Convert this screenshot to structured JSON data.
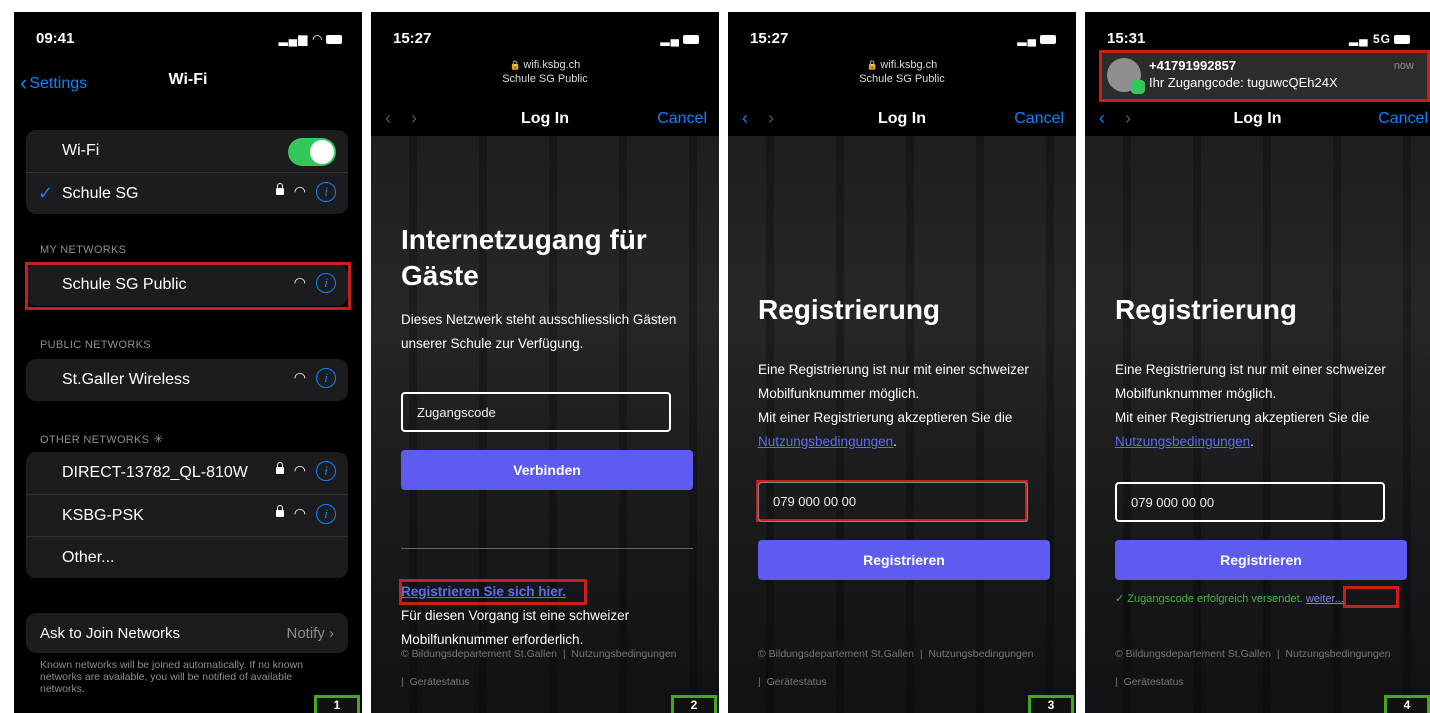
{
  "panel1": {
    "time": "09:41",
    "back_label": "Settings",
    "title": "Wi-Fi",
    "wifi_label": "Wi-Fi",
    "connected_network": "Schule SG",
    "my_networks_header": "MY NETWORKS",
    "my_networks": [
      "Schule SG Public"
    ],
    "public_networks_header": "PUBLIC NETWORKS",
    "public_networks": [
      "St.Galler Wireless"
    ],
    "other_networks_header": "OTHER NETWORKS",
    "other_networks": [
      "DIRECT-13782_QL-810W",
      "KSBG-PSK"
    ],
    "other_label": "Other...",
    "ask_join_label": "Ask to Join Networks",
    "ask_join_value": "Notify",
    "footnote": "Known networks will be joined automatically. If no known networks are available, you will be notified of available networks.",
    "step": "1"
  },
  "panel2": {
    "time": "15:27",
    "url": "wifi.ksbg.ch",
    "network": "Schule SG Public",
    "nav_title": "Log In",
    "cancel": "Cancel",
    "heading": "Internetzugang für Gäste",
    "text": "Dieses Netzwerk steht ausschliesslich Gästen unserer Schule zur Verfügung.",
    "code_placeholder": "Zugangscode",
    "connect_button": "Verbinden",
    "register_link": "Registrieren Sie sich hier.",
    "register_note": "Für diesen Vorgang ist eine schweizer Mobilfunknummer erforderlich.",
    "footer_dept": "© Bildungsdepartement St.Gallen",
    "footer_terms": "Nutzungsbedingungen",
    "footer_status": "Gerätestatus",
    "step": "2"
  },
  "panel3": {
    "time": "15:27",
    "url": "wifi.ksbg.ch",
    "network": "Schule SG Public",
    "nav_title": "Log In",
    "cancel": "Cancel",
    "heading": "Registrierung",
    "text_1": "Eine Registrierung ist nur mit einer schweizer Mobilfunknummer möglich.",
    "text_2": "Mit einer Registrierung akzeptieren Sie die",
    "terms_link": "Nutzungsbedingungen",
    "phone_value": "079 000 00 00",
    "register_button": "Registrieren",
    "footer_dept": "© Bildungsdepartement St.Gallen",
    "footer_terms": "Nutzungsbedingungen",
    "footer_status": "Gerätestatus",
    "step": "3"
  },
  "panel4": {
    "time": "15:31",
    "signal": "5G",
    "notif_sender": "+41791992857",
    "notif_message": "Ihr Zugangcode: tuguwcQEh24X",
    "notif_time": "now",
    "nav_title": "Log In",
    "cancel": "Cancel",
    "heading": "Registrierung",
    "text_1": "Eine Registrierung ist nur mit einer schweizer Mobilfunknummer möglich.",
    "text_2": "Mit einer Registrierung akzeptieren Sie die",
    "terms_link": "Nutzungsbedingungen",
    "phone_value": "079 000 00 00",
    "register_button": "Registrieren",
    "success_text": "Zugangscode erfolgreich versendet.",
    "next_link": "weiter...",
    "footer_dept": "© Bildungsdepartement St.Gallen",
    "footer_terms": "Nutzungsbedingungen",
    "footer_status": "Gerätestatus",
    "step": "4"
  },
  "colors": {
    "accent": "#0a84ff",
    "button": "#5e5cf0",
    "highlight": "#c81e1e",
    "step_border": "#46a81e",
    "toggle_on": "#34c759"
  }
}
